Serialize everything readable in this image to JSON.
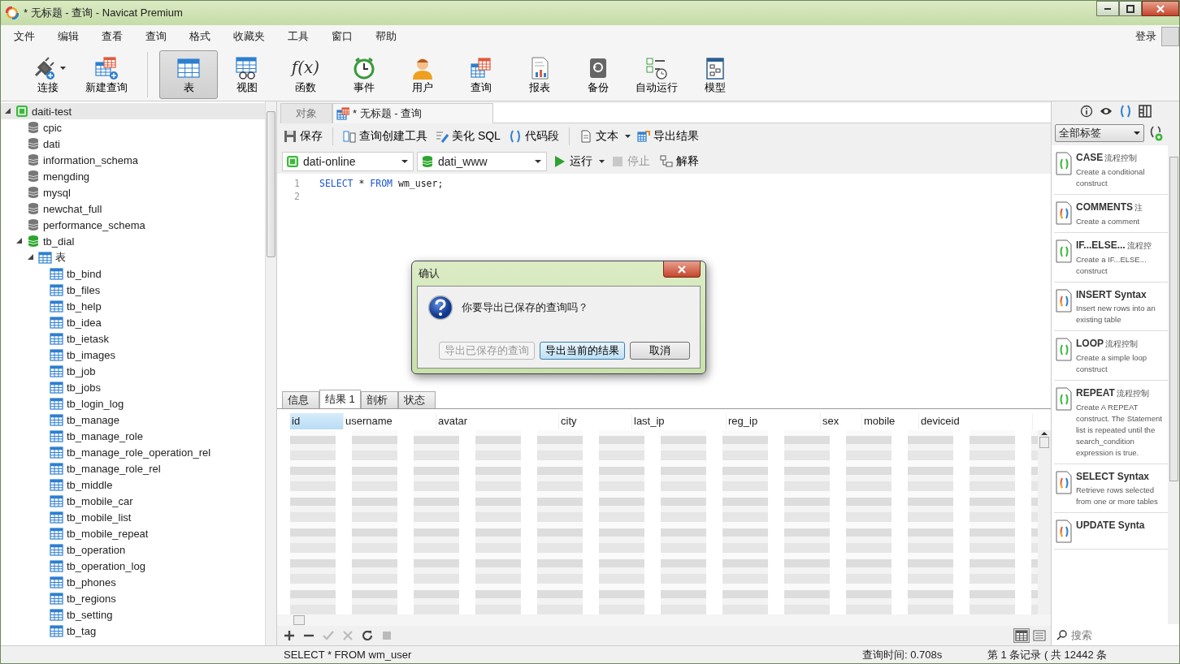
{
  "window": {
    "title": "* 无标题 - 查询 - Navicat Premium"
  },
  "menu": [
    "文件",
    "编辑",
    "查看",
    "查询",
    "格式",
    "收藏夹",
    "工具",
    "窗口",
    "帮助"
  ],
  "login": "登录",
  "toolbar": [
    {
      "label": "连接",
      "selected": false,
      "dropdown": true
    },
    {
      "label": "新建查询",
      "selected": false,
      "dropdown": false
    },
    {
      "label": "表",
      "selected": true,
      "dropdown": false
    },
    {
      "label": "视图",
      "selected": false,
      "dropdown": false
    },
    {
      "label": "函数",
      "glyph": "f(x)",
      "selected": false,
      "dropdown": false
    },
    {
      "label": "事件",
      "selected": false,
      "dropdown": false
    },
    {
      "label": "用户",
      "selected": false,
      "dropdown": false
    },
    {
      "label": "查询",
      "selected": false,
      "dropdown": false
    },
    {
      "label": "报表",
      "selected": false,
      "dropdown": false
    },
    {
      "label": "备份",
      "selected": false,
      "dropdown": false
    },
    {
      "label": "自动运行",
      "selected": false,
      "dropdown": false
    },
    {
      "label": "模型",
      "selected": false,
      "dropdown": false
    }
  ],
  "sidebar": {
    "tree": [
      {
        "label": "daiti-test",
        "kind": "connection",
        "expanded": true,
        "selected": true,
        "children": [
          {
            "label": "cpic",
            "kind": "database"
          },
          {
            "label": "dati",
            "kind": "database"
          },
          {
            "label": "information_schema",
            "kind": "database"
          },
          {
            "label": "mengding",
            "kind": "database"
          },
          {
            "label": "mysql",
            "kind": "database"
          },
          {
            "label": "newchat_full",
            "kind": "database"
          },
          {
            "label": "performance_schema",
            "kind": "database"
          },
          {
            "label": "tb_dial",
            "kind": "database_open",
            "expanded": true,
            "children": [
              {
                "label": "表",
                "kind": "folder",
                "expanded": true,
                "children": [
                  {
                    "label": "tb_bind",
                    "kind": "table"
                  },
                  {
                    "label": "tb_files",
                    "kind": "table"
                  },
                  {
                    "label": "tb_help",
                    "kind": "table"
                  },
                  {
                    "label": "tb_idea",
                    "kind": "table"
                  },
                  {
                    "label": "tb_ietask",
                    "kind": "table"
                  },
                  {
                    "label": "tb_images",
                    "kind": "table"
                  },
                  {
                    "label": "tb_job",
                    "kind": "table"
                  },
                  {
                    "label": "tb_jobs",
                    "kind": "table"
                  },
                  {
                    "label": "tb_login_log",
                    "kind": "table"
                  },
                  {
                    "label": "tb_manage",
                    "kind": "table"
                  },
                  {
                    "label": "tb_manage_role",
                    "kind": "table"
                  },
                  {
                    "label": "tb_manage_role_operation_rel",
                    "kind": "table"
                  },
                  {
                    "label": "tb_manage_role_rel",
                    "kind": "table"
                  },
                  {
                    "label": "tb_middle",
                    "kind": "table"
                  },
                  {
                    "label": "tb_mobile_car",
                    "kind": "table"
                  },
                  {
                    "label": "tb_mobile_list",
                    "kind": "table"
                  },
                  {
                    "label": "tb_mobile_repeat",
                    "kind": "table"
                  },
                  {
                    "label": "tb_operation",
                    "kind": "table"
                  },
                  {
                    "label": "tb_operation_log",
                    "kind": "table"
                  },
                  {
                    "label": "tb_phones",
                    "kind": "table"
                  },
                  {
                    "label": "tb_regions",
                    "kind": "table"
                  },
                  {
                    "label": "tb_setting",
                    "kind": "table"
                  },
                  {
                    "label": "tb_tag",
                    "kind": "table"
                  }
                ]
              }
            ]
          }
        ]
      }
    ]
  },
  "tabs": [
    {
      "label": "对象",
      "selected": false
    },
    {
      "label": "* 无标题 - 查询",
      "selected": true
    }
  ],
  "query_toolbar": [
    {
      "label": "保存",
      "kind": "button"
    },
    {
      "kind": "separator"
    },
    {
      "label": "查询创建工具",
      "kind": "button"
    },
    {
      "label": "美化 SQL",
      "kind": "button"
    },
    {
      "label": "代码段",
      "kind": "button"
    },
    {
      "kind": "separator"
    },
    {
      "label": "文本",
      "kind": "dropdown"
    },
    {
      "label": "导出结果",
      "kind": "button"
    }
  ],
  "connection_select": {
    "value": "dati-online"
  },
  "database_select": {
    "value": "dati_www"
  },
  "run_actions": [
    {
      "label": "运行",
      "dropdown": true,
      "disabled": false
    },
    {
      "label": "停止",
      "dropdown": false,
      "disabled": true
    },
    {
      "label": "解释",
      "dropdown": false,
      "disabled": false
    }
  ],
  "editor": {
    "lines": [
      {
        "number": "1",
        "tokens": [
          {
            "text": "SELECT",
            "kind": "keyword"
          },
          {
            "text": " * ",
            "kind": "plain"
          },
          {
            "text": "FROM",
            "kind": "keyword"
          },
          {
            "text": " wm_user;",
            "kind": "plain"
          }
        ]
      },
      {
        "number": "2"
      }
    ]
  },
  "dialog": {
    "title": "确认",
    "message": "你要导出已保存的查询吗？",
    "buttons": [
      {
        "label": "导出已保存的查询",
        "disabled": true,
        "default": false
      },
      {
        "label": "导出当前的结果",
        "disabled": false,
        "default": true
      },
      {
        "label": "取消",
        "disabled": false,
        "default": false
      }
    ]
  },
  "result_tabs": [
    {
      "label": "信息",
      "selected": false
    },
    {
      "label": "结果 1",
      "selected": true
    },
    {
      "label": "剖析",
      "selected": false
    },
    {
      "label": "状态",
      "selected": false
    }
  ],
  "table": {
    "columns": [
      {
        "label": "id",
        "selected": true
      },
      {
        "label": "username",
        "selected": false
      },
      {
        "label": "avatar",
        "selected": false
      },
      {
        "label": "city",
        "selected": false
      },
      {
        "label": "last_ip",
        "selected": false
      },
      {
        "label": "reg_ip",
        "selected": false
      },
      {
        "label": "sex",
        "selected": false
      },
      {
        "label": "mobile",
        "selected": false
      },
      {
        "label": "deviceid",
        "selected": false
      }
    ]
  },
  "grid_actions": [
    {
      "disabled": false
    },
    {
      "disabled": false
    },
    {
      "disabled": true
    },
    {
      "disabled": true
    },
    {
      "disabled": false
    },
    {
      "disabled": true
    }
  ],
  "view_modes": [
    {
      "selected": true
    },
    {
      "selected": false
    }
  ],
  "right_panel": {
    "tabs": [
      {
        "selected": false
      },
      {
        "selected": false
      },
      {
        "selected": true
      },
      {
        "selected": false
      }
    ],
    "filter": {
      "value": "全部标签"
    },
    "snippets": [
      {
        "title": "CASE",
        "tag": "流程控制",
        "description": "Create a conditional construct",
        "kind": "flow"
      },
      {
        "title": "COMMENTS",
        "tag": "注",
        "description": "Create a comment",
        "kind": "syntax"
      },
      {
        "title": "IF...ELSE...",
        "tag": "流程控",
        "description": "Create a IF...ELSE... construct",
        "kind": "flow"
      },
      {
        "title": "INSERT Syntax",
        "description": "Insert new rows into an existing table",
        "kind": "syntax"
      },
      {
        "title": "LOOP",
        "tag": "流程控制",
        "description": "Create a simple loop construct",
        "kind": "flow"
      },
      {
        "title": "REPEAT",
        "tag": "流程控制",
        "description": "Create A REPEAT construct. The Statement list is repeated until the search_condition expression is true.",
        "kind": "flow"
      },
      {
        "title": "SELECT Syntax",
        "description": "Retrieve rows selected from one or more tables",
        "kind": "syntax"
      },
      {
        "title": "UPDATE Synta",
        "kind": "syntax"
      }
    ],
    "search": {
      "placeholder": "搜索"
    }
  },
  "status_bar": {
    "sql": "SELECT * FROM wm_user",
    "query_time": "查询时间: 0.708s",
    "records": "第 1 条记录 ( 共 12442 条"
  }
}
